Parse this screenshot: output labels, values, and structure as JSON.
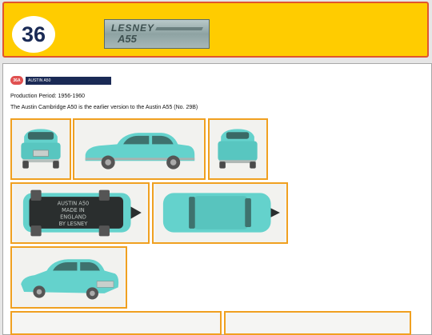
{
  "header": {
    "number": "36",
    "logo_line1": "LESNEY",
    "logo_line2": "A55"
  },
  "model": {
    "code": "36A",
    "name": "AUSTIN A50"
  },
  "text": {
    "production": "Production Period: 1956-1960",
    "description": "The Austin Cambridge A50 is the earlier version to the Austin A55 (No. 29B)"
  },
  "photos": [
    {
      "name": "front view"
    },
    {
      "name": "side view"
    },
    {
      "name": "rear view"
    },
    {
      "name": "underside view"
    },
    {
      "name": "top view"
    },
    {
      "name": "three-quarter view"
    }
  ],
  "colors": {
    "header_bg": "#ffcc00",
    "header_border": "#e0562e",
    "photo_border": "#f0a020",
    "car_body": "#64d2cc",
    "badge_bg": "#1a2a55",
    "badge_red": "#e05050"
  },
  "underside_text": [
    "AUSTIN A50",
    "MADE IN",
    "ENGLAND",
    "BY LESNEY"
  ]
}
